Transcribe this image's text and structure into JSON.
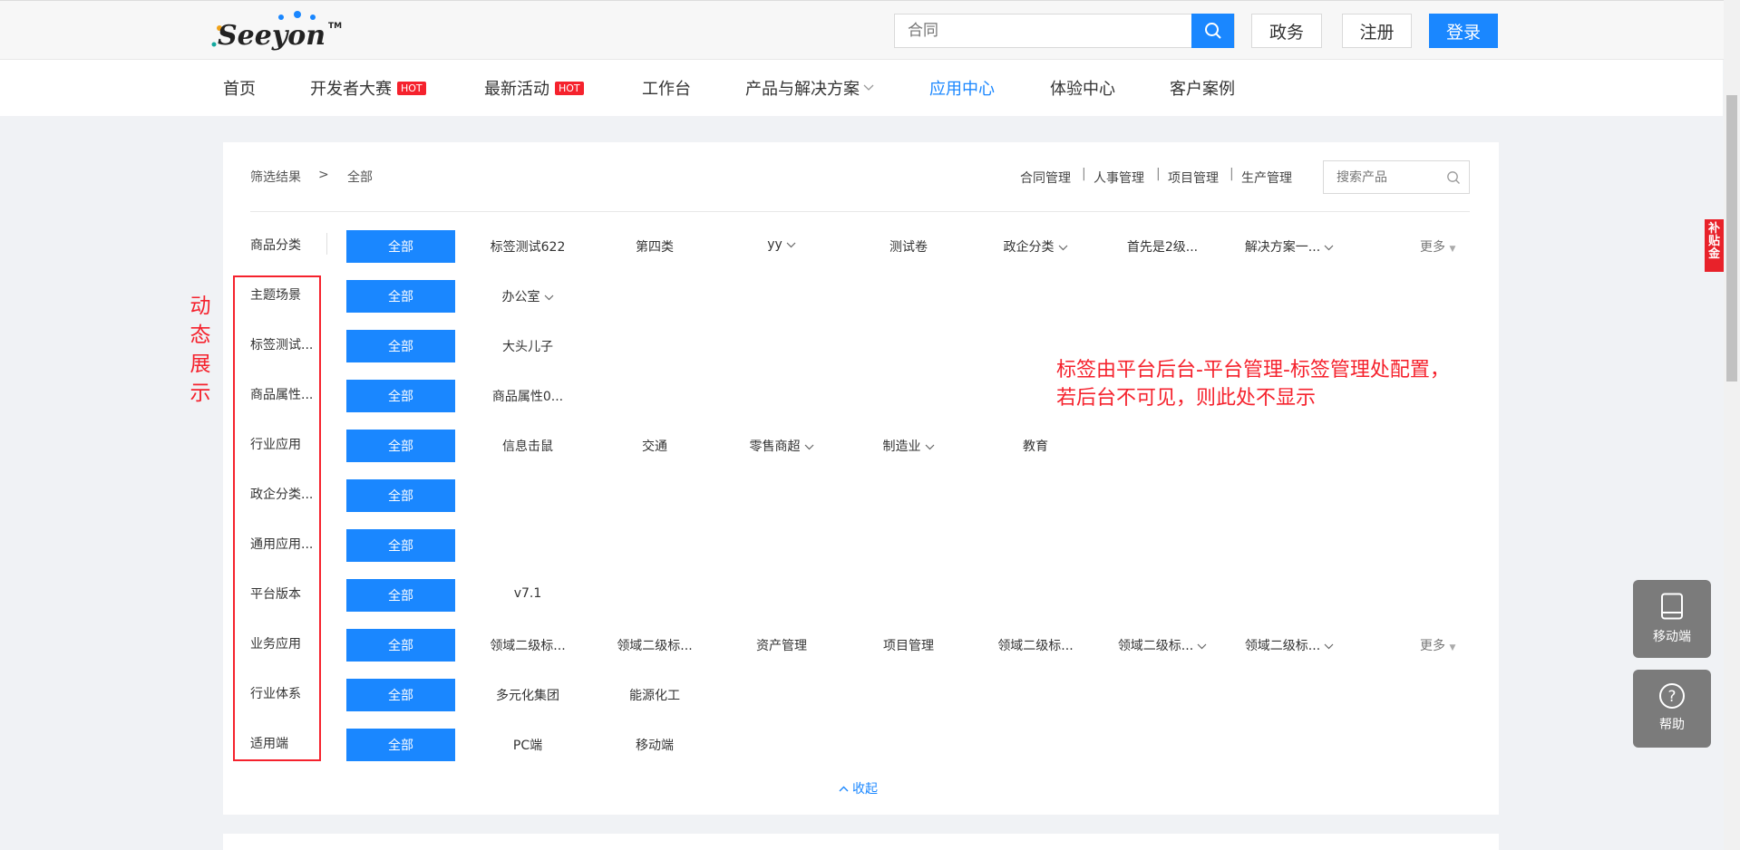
{
  "header": {
    "logo_text": "Seeyon",
    "trademark": "TM",
    "search": {
      "placeholder": "合同"
    },
    "buttons": {
      "gov": "政务",
      "register": "注册",
      "login": "登录"
    },
    "colors": {
      "accent": "#1a87ff",
      "hot": "#f5222d"
    }
  },
  "nav": {
    "items": [
      {
        "label": "首页"
      },
      {
        "label": "开发者大赛",
        "badge": "HOT"
      },
      {
        "label": "最新活动",
        "badge": "HOT"
      },
      {
        "label": "工作台"
      },
      {
        "label": "产品与解决方案"
      },
      {
        "label": "应用中心",
        "active": true
      },
      {
        "label": "体验中心"
      },
      {
        "label": "客户案例"
      }
    ]
  },
  "filter": {
    "breadcrumb": {
      "label": "筛选结果",
      "sep": ">",
      "current": "全部"
    },
    "quick_links": [
      "合同管理",
      "人事管理",
      "项目管理",
      "生产管理"
    ],
    "quick_sep": "|",
    "search_placeholder": "搜索产品",
    "all_label": "全部",
    "more_label": "更多",
    "collapse_label": "收起",
    "rows": [
      {
        "label": "商品分类",
        "options": [
          "标签测试622",
          "第四类",
          "yy",
          "测试卷",
          "政企分类",
          "首先是2级...",
          "解决方案一..."
        ],
        "has_more": true
      },
      {
        "label": "主题场景",
        "options": [
          "办公室"
        ]
      },
      {
        "label": "标签测试...",
        "options": [
          "大头儿子"
        ]
      },
      {
        "label": "商品属性...",
        "options": [
          "商品属性0..."
        ]
      },
      {
        "label": "行业应用",
        "options": [
          "信息击鼠",
          "交通",
          "零售商超",
          "制造业",
          "教育"
        ]
      },
      {
        "label": "政企分类...",
        "options": []
      },
      {
        "label": "通用应用...",
        "options": []
      },
      {
        "label": "平台版本",
        "options": [
          "v7.1"
        ]
      },
      {
        "label": "业务应用",
        "options": [
          "领域二级标...",
          "领域二级标...",
          "资产管理",
          "项目管理",
          "领域二级标...",
          "领域二级标...",
          "领域二级标..."
        ],
        "has_more": true
      },
      {
        "label": "行业体系",
        "options": [
          "多元化集团",
          "能源化工"
        ]
      },
      {
        "label": "适用端",
        "options": [
          "PC端",
          "移动端"
        ]
      }
    ]
  },
  "annotations": {
    "dynamic": "动态展示",
    "note_line1": "标签由平台后台-平台管理-标签管理处配置，",
    "note_line2": "若后台不可见，则此处不显示"
  },
  "floating": {
    "subsidy": "补贴金",
    "mobile": "移动端",
    "help": "帮助"
  }
}
